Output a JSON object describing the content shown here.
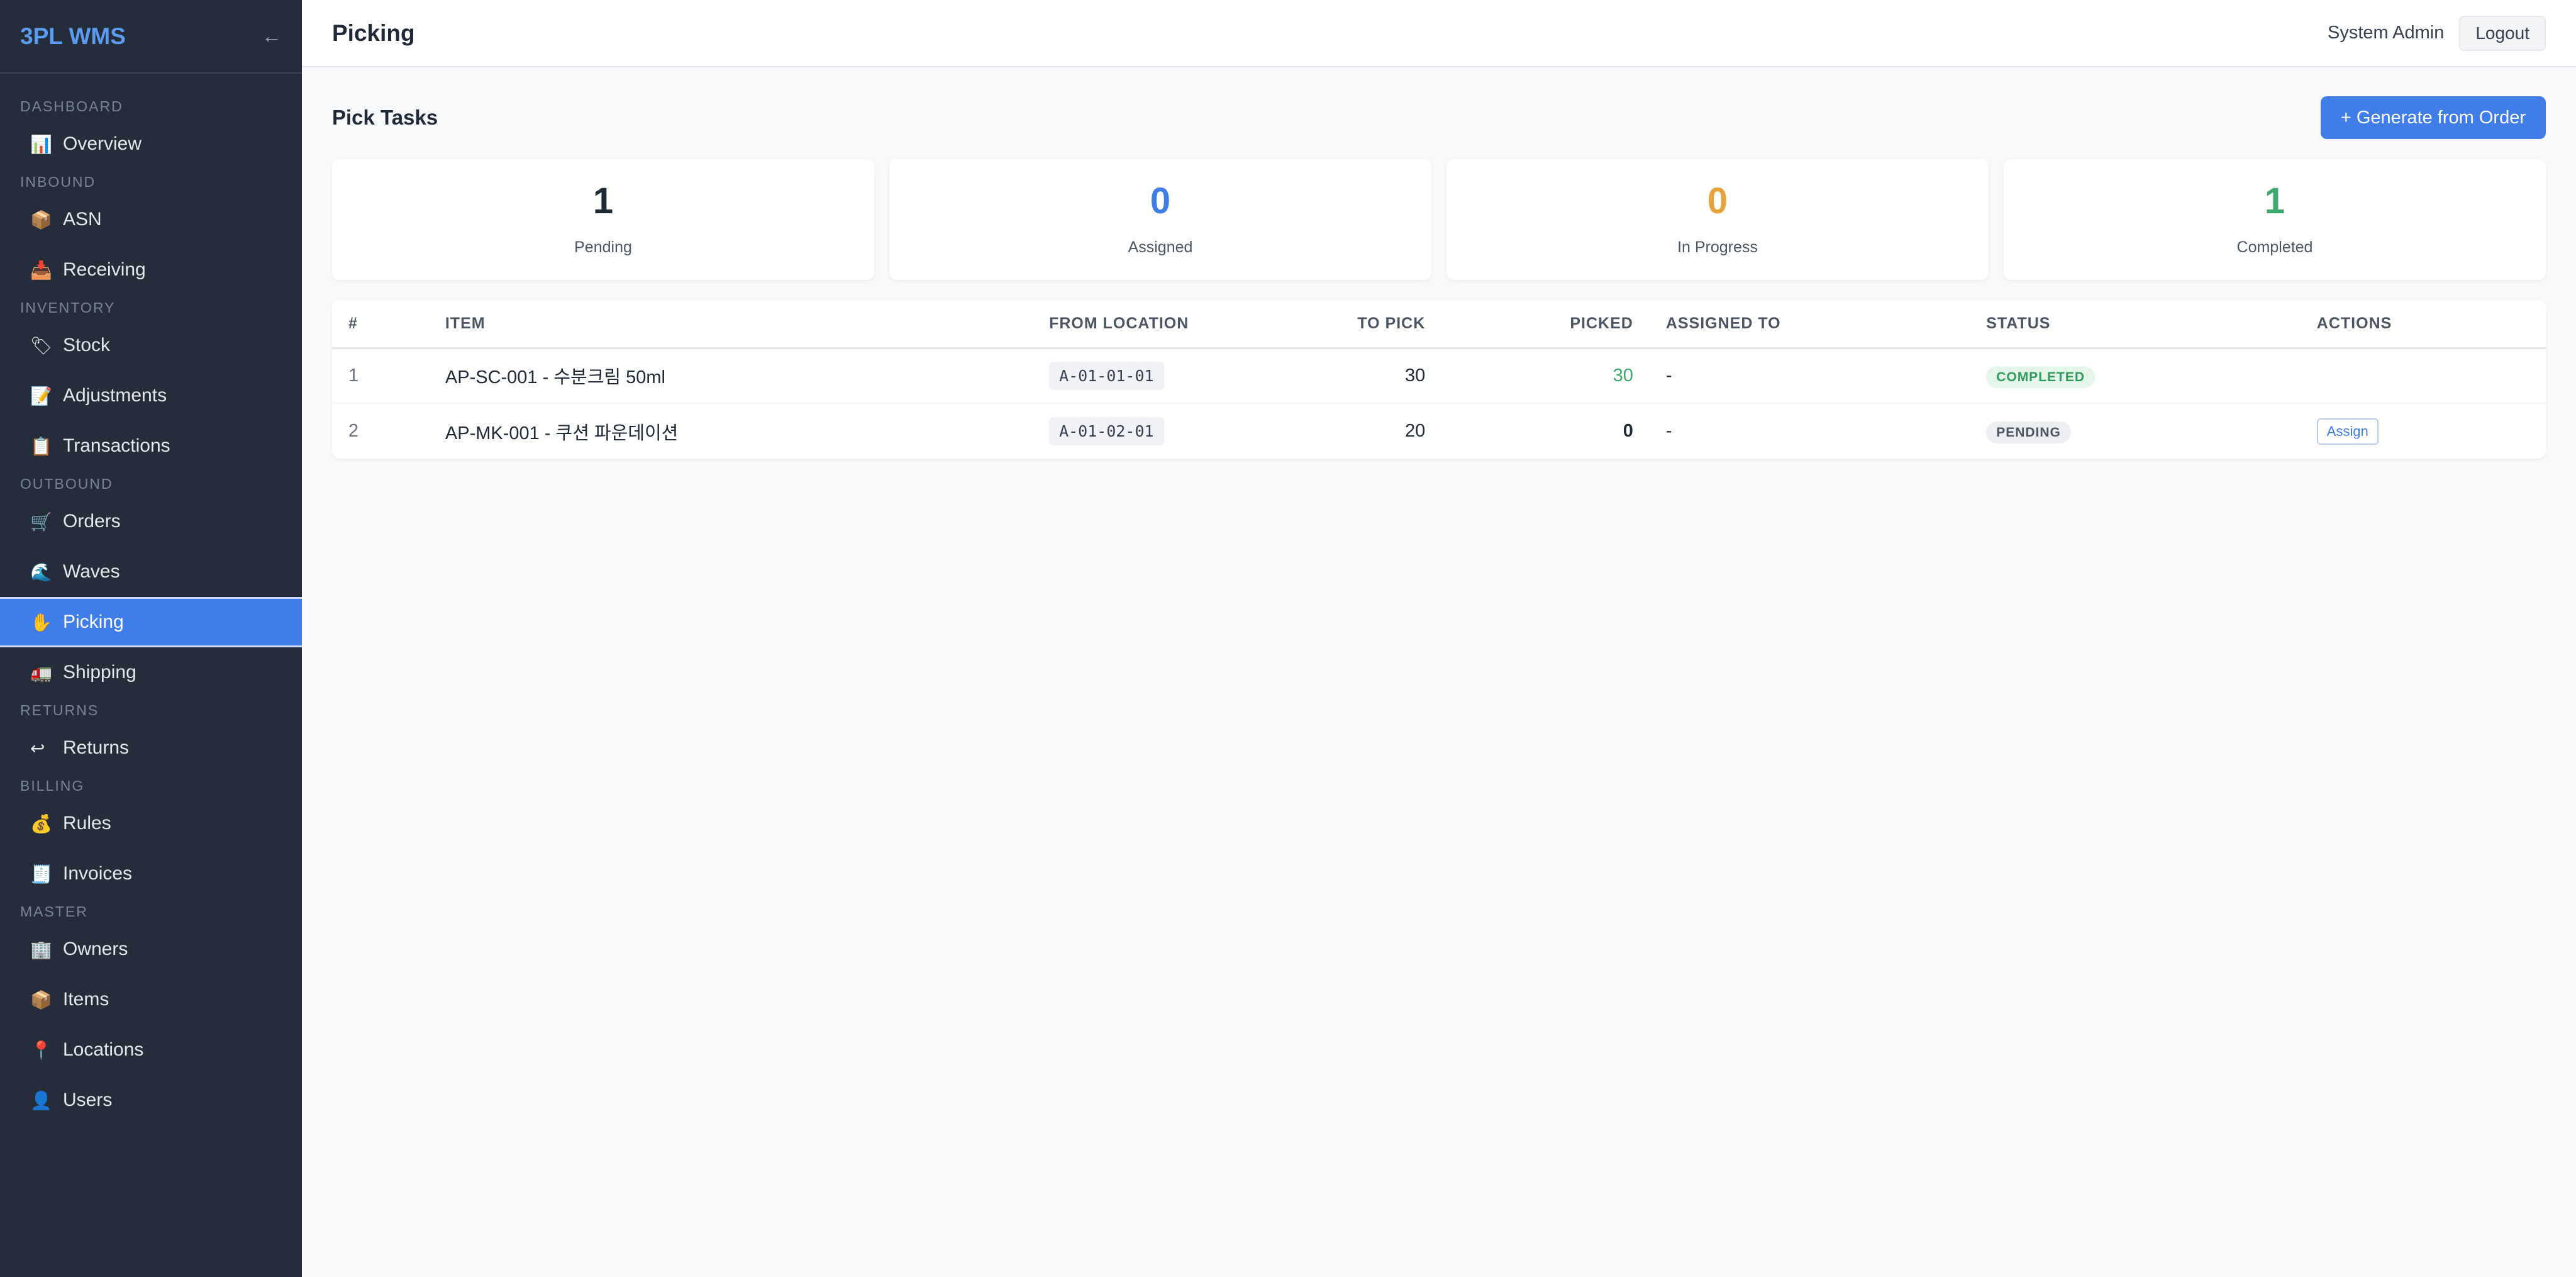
{
  "brand": {
    "title": "3PL WMS",
    "collapse_glyph": "←"
  },
  "sidebar": {
    "sections": [
      {
        "label": "DASHBOARD",
        "items": [
          {
            "icon": "📊",
            "icon_name": "chart-icon",
            "label": "Overview"
          }
        ]
      },
      {
        "label": "INBOUND",
        "items": [
          {
            "icon": "📦",
            "icon_name": "package-icon",
            "label": "ASN"
          },
          {
            "icon": "📥",
            "icon_name": "inbox-icon",
            "label": "Receiving"
          }
        ]
      },
      {
        "label": "INVENTORY",
        "items": [
          {
            "icon": "🏷",
            "icon_name": "tag-icon",
            "label": "Stock"
          },
          {
            "icon": "📝",
            "icon_name": "memo-icon",
            "label": "Adjustments"
          },
          {
            "icon": "📋",
            "icon_name": "clipboard-icon",
            "label": "Transactions"
          }
        ]
      },
      {
        "label": "OUTBOUND",
        "items": [
          {
            "icon": "🛒",
            "icon_name": "cart-icon",
            "label": "Orders"
          },
          {
            "icon": "🌊",
            "icon_name": "wave-icon",
            "label": "Waves"
          },
          {
            "icon": "✋",
            "icon_name": "hand-icon",
            "label": "Picking",
            "active": true
          },
          {
            "icon": "🚛",
            "icon_name": "truck-icon",
            "label": "Shipping"
          }
        ]
      },
      {
        "label": "RETURNS",
        "items": [
          {
            "icon": "↩",
            "icon_name": "return-icon",
            "label": "Returns"
          }
        ]
      },
      {
        "label": "BILLING",
        "items": [
          {
            "icon": "💰",
            "icon_name": "money-bag-icon",
            "label": "Rules"
          },
          {
            "icon": "🧾",
            "icon_name": "receipt-icon",
            "label": "Invoices"
          }
        ]
      },
      {
        "label": "MASTER",
        "items": [
          {
            "icon": "🏢",
            "icon_name": "building-icon",
            "label": "Owners"
          },
          {
            "icon": "📦",
            "icon_name": "package-icon",
            "label": "Items"
          },
          {
            "icon": "📍",
            "icon_name": "pin-icon",
            "label": "Locations"
          },
          {
            "icon": "👤",
            "icon_name": "user-icon",
            "label": "Users"
          }
        ]
      }
    ]
  },
  "header": {
    "title": "Picking",
    "user": "System Admin",
    "logout_label": "Logout"
  },
  "main": {
    "section_title": "Pick Tasks",
    "generate_label": "+ Generate from Order",
    "stats": [
      {
        "value": "1",
        "label": "Pending",
        "color": "#1f2937"
      },
      {
        "value": "0",
        "label": "Assigned",
        "color": "#3f7de8"
      },
      {
        "value": "0",
        "label": "In Progress",
        "color": "#e8a23c"
      },
      {
        "value": "1",
        "label": "Completed",
        "color": "#3daa6d"
      }
    ],
    "table": {
      "headers": [
        "#",
        "ITEM",
        "FROM LOCATION",
        "TO PICK",
        "PICKED",
        "ASSIGNED TO",
        "STATUS",
        "ACTIONS"
      ],
      "rows": [
        {
          "num": "1",
          "item": "AP-SC-001 - 수분크림 50ml",
          "location": "A-01-01-01",
          "to_pick": "30",
          "picked": "30",
          "assigned": "-",
          "status": "COMPLETED",
          "action": ""
        },
        {
          "num": "2",
          "item": "AP-MK-001 - 쿠션 파운데이션",
          "location": "A-01-02-01",
          "to_pick": "20",
          "picked": "0",
          "assigned": "-",
          "status": "PENDING",
          "action": "Assign"
        }
      ]
    }
  }
}
